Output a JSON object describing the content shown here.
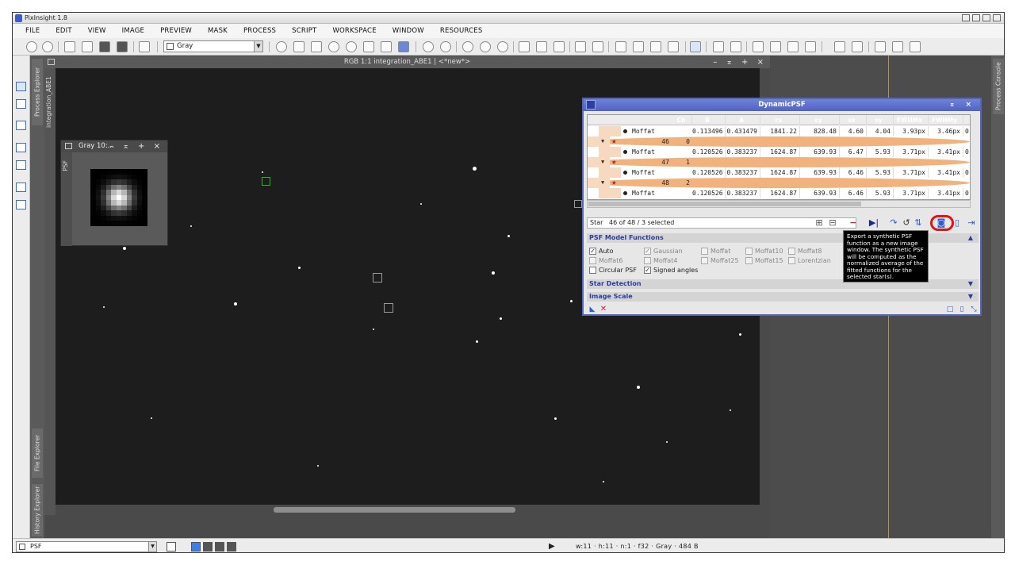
{
  "app": {
    "title": "PixInsight 1.8"
  },
  "menu": [
    "FILE",
    "EDIT",
    "VIEW",
    "IMAGE",
    "PREVIEW",
    "MASK",
    "PROCESS",
    "SCRIPT",
    "WORKSPACE",
    "WINDOW",
    "RESOURCES"
  ],
  "toolbar": {
    "colorspace_value": "Gray"
  },
  "explorer_tabs": {
    "process_explorer": "Process Explorer",
    "file_explorer": "File Explorer",
    "history_explorer": "History Explorer",
    "process_console": "Process Console"
  },
  "image_window": {
    "title": "RGB 1:1 integration_ABE1 | <*new*>",
    "side_label": "integration_ABE1"
  },
  "psf_window": {
    "title": "Gray 10:...",
    "side_label": "PSF"
  },
  "dynamic_psf": {
    "title": "DynamicPSF",
    "columns": [
      "Ch",
      "B",
      "A",
      "cx",
      "cy",
      "sx",
      "sy",
      "FWHMx",
      "FWHMy"
    ],
    "rows": [
      {
        "kind": "fit",
        "func": "Moffat",
        "B": "0.113496",
        "A": "0.431479",
        "cx": "1841.22",
        "cy": "828.48",
        "sx": "4.60",
        "sy": "4.04",
        "fwhmx": "3.93px",
        "fwhmy": "3.46px",
        "extra": "0"
      },
      {
        "kind": "star",
        "id": "46",
        "ch": "0"
      },
      {
        "kind": "fit",
        "func": "Moffat",
        "B": "0.120526",
        "A": "0.383237",
        "cx": "1624.87",
        "cy": "639.93",
        "sx": "6.47",
        "sy": "5.93",
        "fwhmx": "3.71px",
        "fwhmy": "3.41px",
        "extra": "0"
      },
      {
        "kind": "star",
        "id": "47",
        "ch": "1"
      },
      {
        "kind": "fit",
        "func": "Moffat",
        "B": "0.120526",
        "A": "0.383237",
        "cx": "1624.87",
        "cy": "639.93",
        "sx": "6.46",
        "sy": "5.93",
        "fwhmx": "3.71px",
        "fwhmy": "3.41px",
        "extra": "0"
      },
      {
        "kind": "star",
        "id": "48",
        "ch": "2"
      },
      {
        "kind": "fit",
        "func": "Moffat",
        "B": "0.120526",
        "A": "0.383237",
        "cx": "1624.87",
        "cy": "639.93",
        "sx": "6.46",
        "sy": "5.93",
        "fwhmx": "3.71px",
        "fwhmy": "3.41px",
        "extra": "0"
      }
    ],
    "status_label": "Star",
    "status_value": "46 of   48 / 3 selected",
    "sections": {
      "model_functions": "PSF Model Functions",
      "star_detection": "Star Detection",
      "image_scale": "Image Scale"
    },
    "options": {
      "auto": {
        "label": "Auto",
        "checked": true,
        "enabled": true
      },
      "gaussian": {
        "label": "Gaussian",
        "checked": true,
        "enabled": false
      },
      "moffat": {
        "label": "Moffat",
        "checked": false,
        "enabled": false
      },
      "moffat10": {
        "label": "Moffat10",
        "checked": false,
        "enabled": false
      },
      "moffat8": {
        "label": "Moffat8",
        "checked": false,
        "enabled": false
      },
      "moffat6": {
        "label": "Moffat6",
        "checked": false,
        "enabled": false
      },
      "moffat4": {
        "label": "Moffat4",
        "checked": false,
        "enabled": false
      },
      "moffat25": {
        "label": "Moffat25",
        "checked": false,
        "enabled": false
      },
      "moffat15": {
        "label": "Moffat15",
        "checked": false,
        "enabled": false
      },
      "lorentzian": {
        "label": "Lorentzian",
        "checked": false,
        "enabled": false
      },
      "circular_psf": {
        "label": "Circular PSF",
        "checked": false,
        "enabled": true
      },
      "signed_angles": {
        "label": "Signed angles",
        "checked": true,
        "enabled": true
      }
    },
    "tooltip": "Export a synthetic PSF function as a new image window. The synthetic PSF will be computed as the normalized average of the fitted functions for the selected star(s)."
  },
  "bottom": {
    "view_selector": "PSF",
    "info": "w:11 · h:11 · n:1 · f32 · Gray · 484 B"
  },
  "colors": {
    "accent": "#5063c4",
    "star_row": "#f1b27e",
    "highlight": "#e01414",
    "section_text": "#2d3d9e"
  }
}
